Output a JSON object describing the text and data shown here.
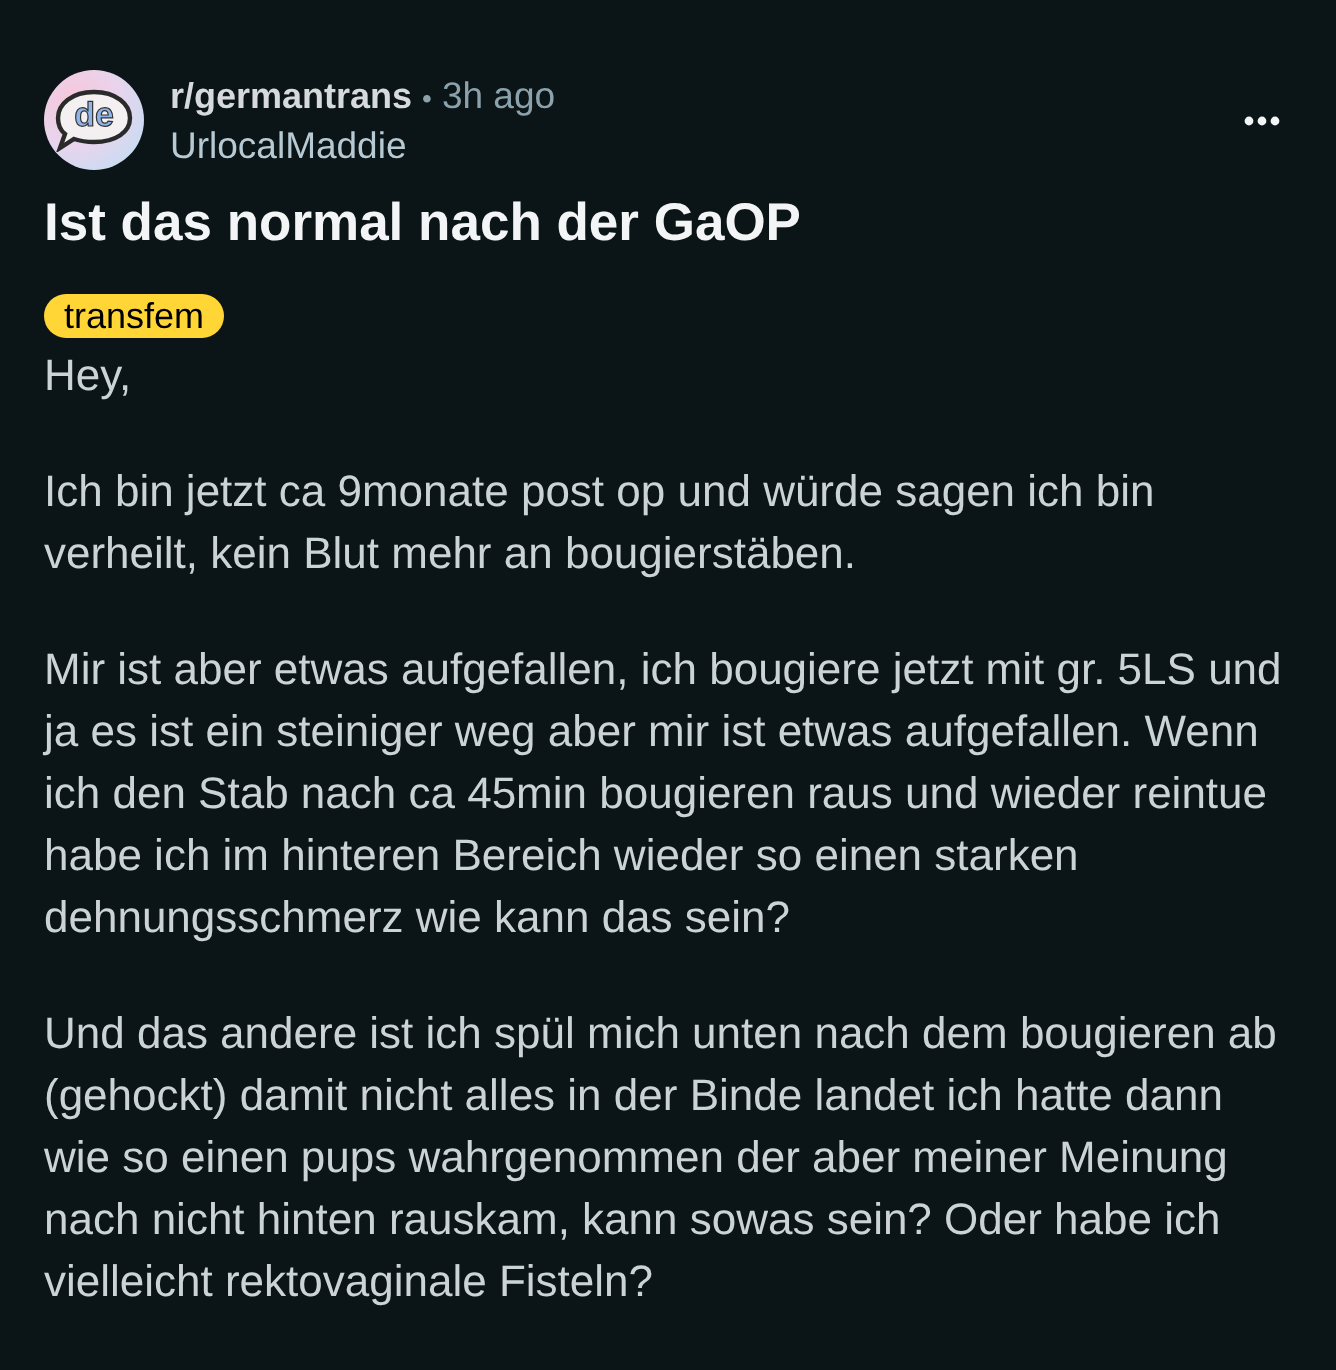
{
  "post": {
    "avatar_text": "de",
    "subreddit": "r/germantrans",
    "separator": "•",
    "age": "3h ago",
    "author": "UrlocalMaddie",
    "title": "Ist das normal nach der GaOP",
    "flair": "transfem",
    "paragraphs": [
      [
        "Hey,"
      ],
      [
        "Ich bin jetzt ca 9monate post op und würde sagen ich bin",
        "verheilt, kein Blut mehr an bougierstäben."
      ],
      [
        "Mir ist aber etwas aufgefallen, ich bougiere jetzt mit gr. 5LS und",
        "ja es ist ein steiniger weg aber mir ist etwas aufgefallen. Wenn",
        "ich den Stab nach ca 45min bougieren raus und wieder reintue",
        "habe ich im hinteren Bereich wieder so einen starken",
        "dehnungsschmerz wie kann das sein?"
      ],
      [
        "Und das andere ist ich spül mich unten nach dem bougieren ab",
        "(gehockt) damit nicht alles in der Binde landet ich hatte dann",
        "wie so einen pups wahrgenommen der aber meiner Meinung",
        "nach nicht hinten rauskam, kann sowas sein? Oder habe ich",
        "vielleicht rektovaginale Fisteln?"
      ]
    ]
  }
}
